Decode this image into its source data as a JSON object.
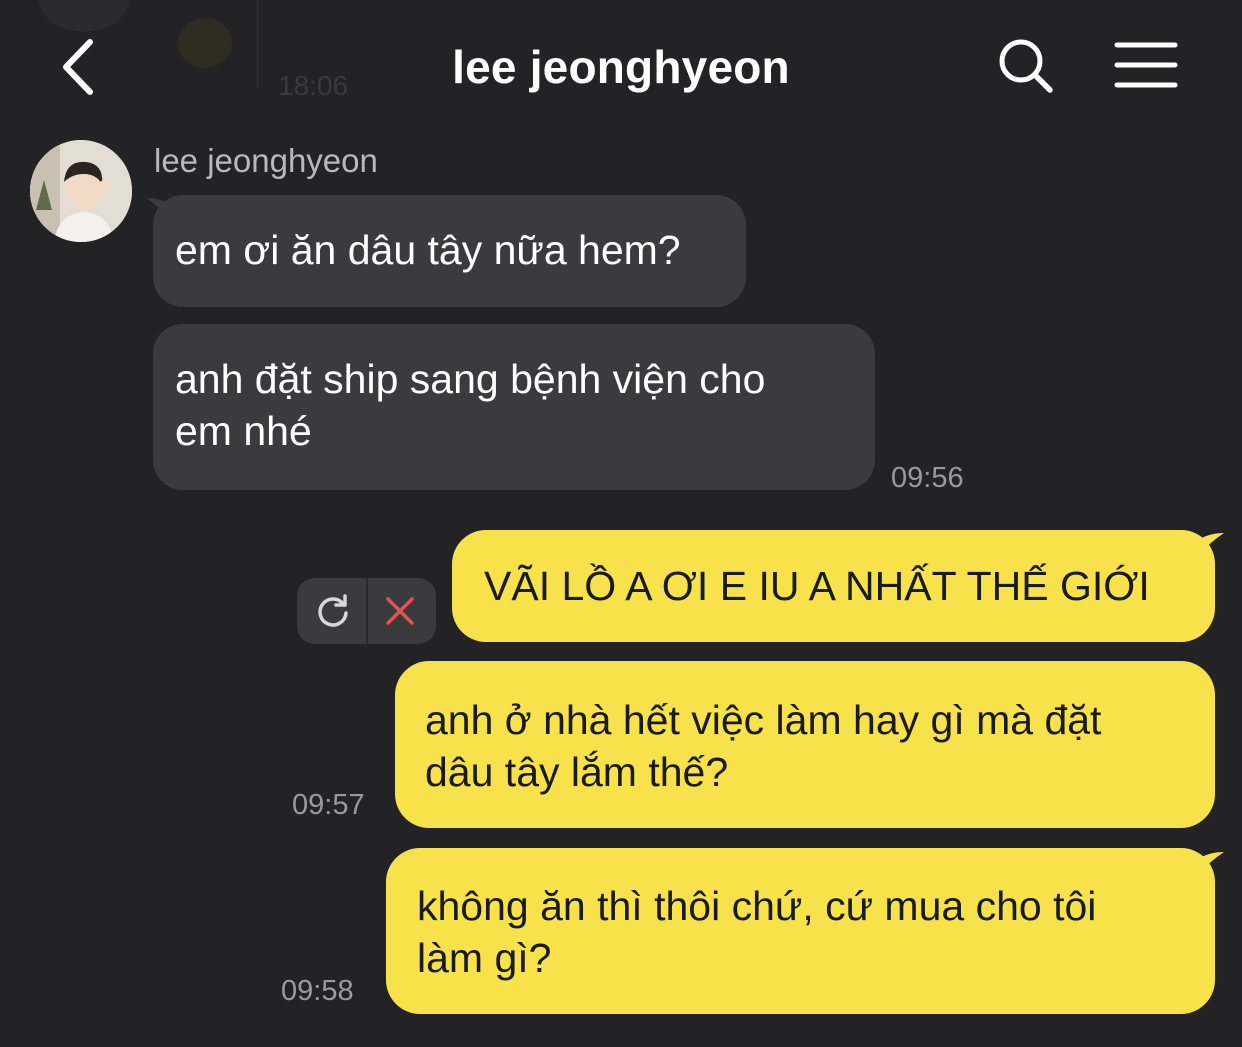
{
  "header": {
    "title": "lee jeonghyeon",
    "back_icon": "chevron-left-icon",
    "search_icon": "search-icon",
    "menu_icon": "hamburger-menu-icon"
  },
  "ghost": {
    "time": "18:06"
  },
  "colors": {
    "background": "#232325",
    "incoming_bubble": "#3b3b3e",
    "outgoing_bubble": "#f7e24b",
    "timestamp": "#9a9a9e",
    "delete_x": "#e0534f"
  },
  "conversation": {
    "sender_name": "lee jeonghyeon",
    "incoming": [
      {
        "line1": "em ơi ăn dâu tây nữa hem?"
      },
      {
        "line1": "anh đặt ship sang bệnh viện cho",
        "line2": "em nhé",
        "time": "09:56"
      }
    ],
    "outgoing": [
      {
        "line1": "VÃI LỒ A ƠI E IU A NHẤT THẾ GIỚI"
      },
      {
        "line1": "anh ở nhà hết việc làm hay gì mà đặt",
        "line2": "dâu tây lắm thế?",
        "time": "09:57"
      },
      {
        "line1": "không ăn thì thôi chứ, cứ mua cho tôi",
        "line2": "làm gì?",
        "time": "09:58"
      }
    ],
    "failed_actions": {
      "retry_icon": "refresh-icon",
      "delete_icon": "close-icon"
    }
  }
}
